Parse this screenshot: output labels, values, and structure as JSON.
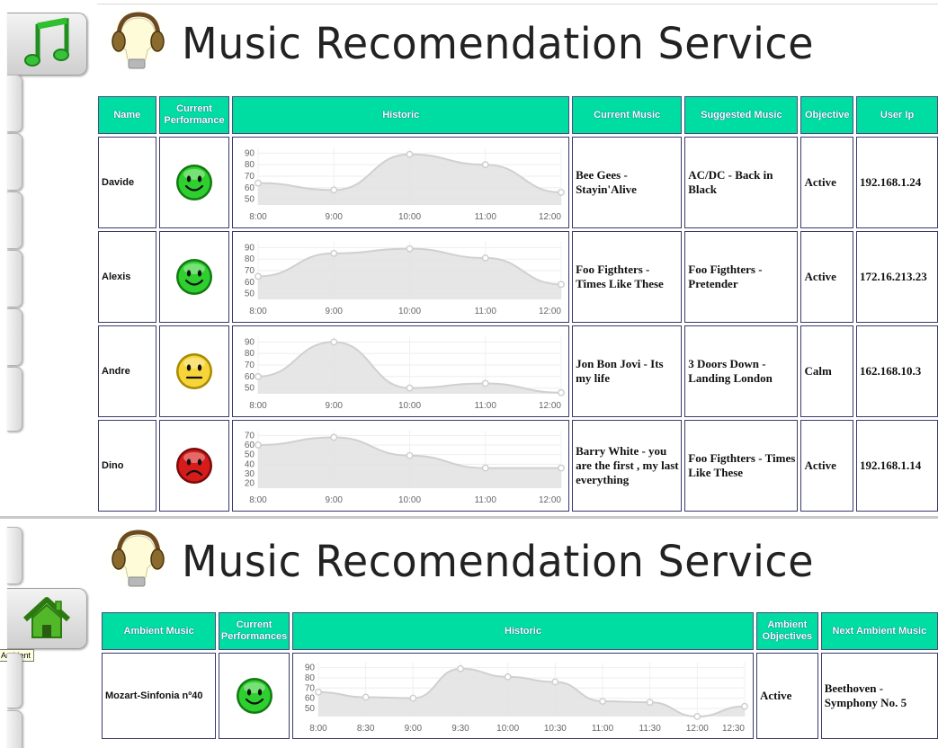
{
  "app_title": "Music Recomendation Service",
  "tooltip": "Ambient",
  "users_table": {
    "headers": [
      "Name",
      "Current Performance",
      "Historic",
      "Current Music",
      "Suggested Music",
      "Objective",
      "User Ip"
    ],
    "rows": [
      {
        "name": "Davide",
        "mood": "happy",
        "current_music": "Bee Gees - Stayin'Alive",
        "suggested_music": "AC/DC - Back in Black",
        "objective": "Active",
        "ip": "192.168.1.24"
      },
      {
        "name": "Alexis",
        "mood": "happy",
        "current_music": "Foo Figthters - Times Like These",
        "suggested_music": "Foo Figthters - Pretender",
        "objective": "Active",
        "ip": "172.16.213.23"
      },
      {
        "name": "Andre",
        "mood": "neutral",
        "current_music": "Jon Bon Jovi - Its my life",
        "suggested_music": "3 Doors Down - Landing London",
        "objective": "Calm",
        "ip": "162.168.10.3"
      },
      {
        "name": "Dino",
        "mood": "sad",
        "current_music": "Barry White - you are the first , my last everything",
        "suggested_music": "Foo Figthters - Times Like These",
        "objective": "Active",
        "ip": "192.168.1.14"
      }
    ]
  },
  "ambient_table": {
    "headers": [
      "Ambient Music",
      "Current Performances",
      "Historic",
      "Ambient Objectives",
      "Next Ambient Music"
    ],
    "rows": [
      {
        "ambient_music": "Mozart-Sinfonia nº40",
        "mood": "happy",
        "objective": "Active",
        "next_music": "Beethoven - Symphony No. 5"
      }
    ]
  },
  "chart_data": [
    {
      "type": "area",
      "x": [
        "8:00",
        "9:00",
        "10:00",
        "11:00",
        "12:00"
      ],
      "values": [
        64,
        58,
        89,
        80,
        56
      ],
      "yticks": [
        90,
        80,
        70,
        60,
        50
      ],
      "ylim": [
        45,
        95
      ]
    },
    {
      "type": "area",
      "x": [
        "8:00",
        "9:00",
        "10:00",
        "11:00",
        "12:00"
      ],
      "values": [
        65,
        85,
        89,
        81,
        58
      ],
      "yticks": [
        90,
        80,
        70,
        60,
        50
      ],
      "ylim": [
        45,
        95
      ]
    },
    {
      "type": "area",
      "x": [
        "8:00",
        "9:00",
        "10:00",
        "11:00",
        "12:00"
      ],
      "values": [
        60,
        90,
        50,
        54,
        46
      ],
      "yticks": [
        90,
        80,
        70,
        60,
        50
      ],
      "ylim": [
        45,
        95
      ]
    },
    {
      "type": "area",
      "x": [
        "8:00",
        "9:00",
        "10:00",
        "11:00",
        "12:00"
      ],
      "values": [
        60,
        68,
        49,
        36,
        36
      ],
      "yticks": [
        70,
        60,
        50,
        40,
        30,
        20
      ],
      "ylim": [
        15,
        75
      ]
    },
    {
      "type": "area",
      "x": [
        "8:00",
        "8:30",
        "9:00",
        "9:30",
        "10:00",
        "10:30",
        "11:00",
        "11:30",
        "12:00",
        "12:30"
      ],
      "values": [
        66,
        61,
        60,
        89,
        81,
        76,
        57,
        56,
        42,
        52
      ],
      "yticks": [
        90,
        80,
        70,
        60,
        50
      ],
      "ylim": [
        42,
        95
      ]
    }
  ],
  "colors": {
    "header_bg": "#00dda3",
    "border": "#3a3a6a",
    "happy": "#2fcf2f",
    "neutral": "#f6d43a",
    "sad": "#d61b1b"
  },
  "icons": {
    "tab_music": "music-note-icon",
    "tab_home": "home-icon",
    "logo": "bulb-headphones-icon"
  }
}
